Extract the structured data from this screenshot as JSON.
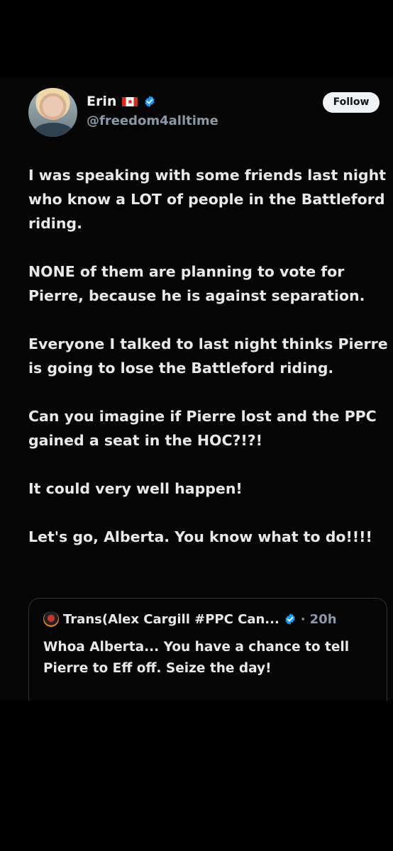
{
  "author": {
    "name": "Erin",
    "flag_icon": "canada-flag-icon",
    "verified_icon": "verified-badge-icon",
    "handle": "@freedom4alltime"
  },
  "follow_button": {
    "label": "Follow"
  },
  "post": {
    "paragraphs": [
      "I was speaking with some friends last night who know a LOT of people in the Battleford riding.",
      "NONE of them are planning to vote for Pierre, because he is against separation.",
      "Everyone I talked to last night thinks Pierre is going to lose the Battleford riding.",
      "Can you imagine if Pierre lost and the PPC gained a seat in the HOC?!?!",
      "It could very well happen!",
      "Let's go, Alberta. You know what to do!!!!"
    ]
  },
  "quoted_post": {
    "author_name": "Trans(Alex Cargill #PPC Can...",
    "dot": "·",
    "time": "20h",
    "text": "Whoa Alberta... You have a chance to tell Pierre to Eff off.  Seize the day!"
  },
  "colors": {
    "background": "#000000",
    "verified_blue": "#1d9bf0",
    "secondary_text": "#8b98a5",
    "follow_bg": "#eff3f4"
  }
}
